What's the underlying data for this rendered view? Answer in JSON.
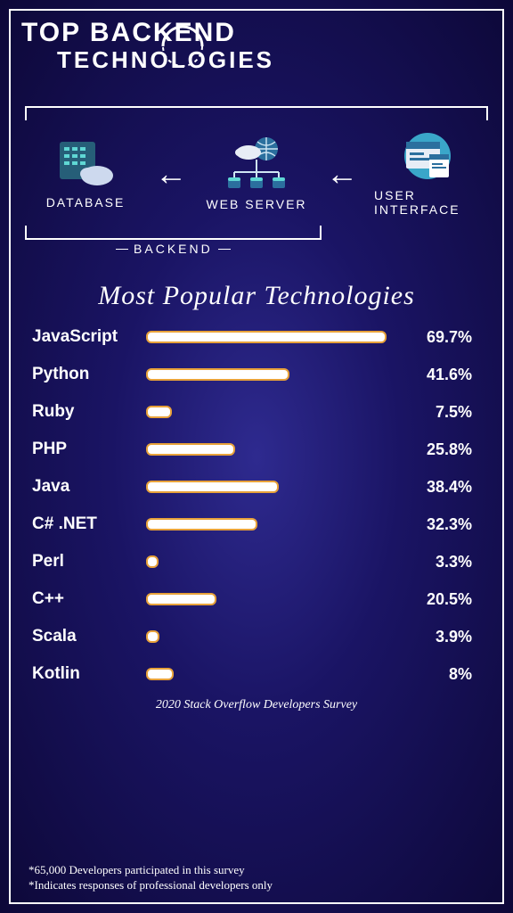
{
  "header": {
    "line1": "TOP BACKEND",
    "line2": "TECHNOLOGIES"
  },
  "diagram": {
    "database": "DATABASE",
    "webserver": "WEB SERVER",
    "ui": "USER INTERFACE",
    "backend": "BACKEND"
  },
  "chart_title": "Most Popular Technologies",
  "chart_data": {
    "type": "bar",
    "title": "Most Popular Technologies",
    "xlabel": "",
    "ylabel": "",
    "categories": [
      "JavaScript",
      "Python",
      "Ruby",
      "PHP",
      "Java",
      "C# .NET",
      "Perl",
      "C++",
      "Scala",
      "Kotlin"
    ],
    "values": [
      69.7,
      41.6,
      7.5,
      25.8,
      38.4,
      32.3,
      3.3,
      20.5,
      3.9,
      8.0
    ],
    "ylim": [
      0,
      100
    ],
    "source": "2020 Stack Overflow Developers Survey"
  },
  "source": "2020 Stack Overflow Developers Survey",
  "footnotes": {
    "f1": "*65,000 Developers participated in this survey",
    "f2": "*Indicates responses of professional developers only"
  }
}
